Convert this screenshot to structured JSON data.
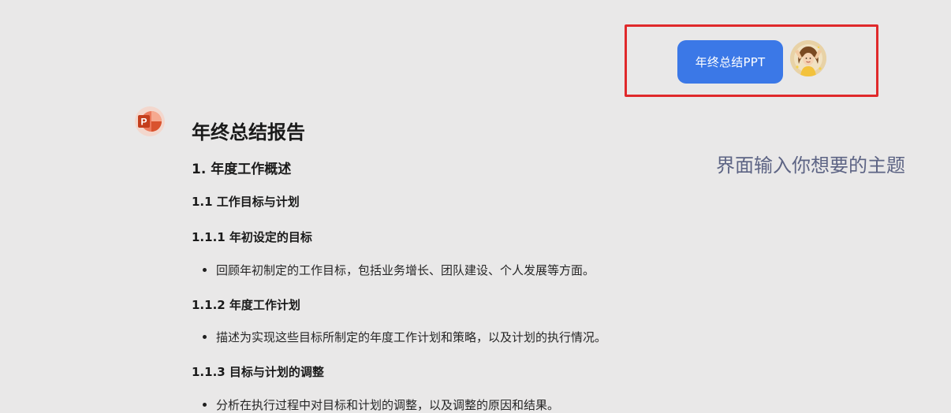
{
  "conversation": {
    "user_message": "年终总结PPT",
    "hint": "界面输入你想要的主题"
  },
  "document": {
    "title": "年终总结报告",
    "section_1": "1. 年度工作概述",
    "section_1_1": "1.1 工作目标与计划",
    "section_1_1_1": "1.1.1 年初设定的目标",
    "bullet_1": "回顾年初制定的工作目标，包括业务增长、团队建设、个人发展等方面。",
    "section_1_1_2": "1.1.2 年度工作计划",
    "bullet_2": "描述为实现这些目标所制定的年度工作计划和策略，以及计划的执行情况。",
    "section_1_1_3": "1.1.3 目标与计划的调整",
    "bullet_3": "分析在执行过程中对目标和计划的调整，以及调整的原因和结果。"
  },
  "icons": {
    "bot_avatar": "powerpoint-icon",
    "user_avatar": "user-avatar-icon"
  },
  "colors": {
    "background": "#e9e8e8",
    "user_bubble": "#3b78e7",
    "highlight_border": "#e0292b",
    "hint_text": "#5d6484",
    "powerpoint_brand": "#d24726"
  }
}
